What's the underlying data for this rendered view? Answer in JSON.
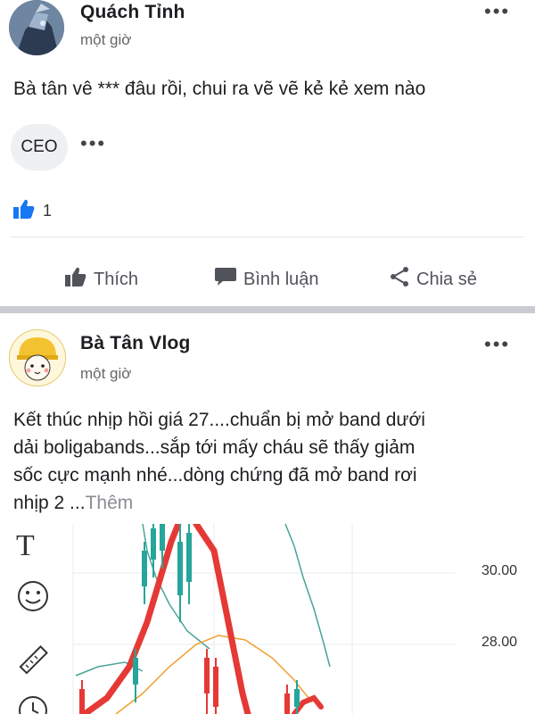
{
  "posts": [
    {
      "author": "Quách Tỉnh",
      "time": "một giờ",
      "text": "Bà tân vê *** đâu rồi, chui ra vẽ vẽ kẻ kẻ xem nào",
      "tag": "CEO",
      "reaction_count": "1",
      "actions": {
        "like": "Thích",
        "comment": "Bình luận",
        "share": "Chia sẻ"
      }
    },
    {
      "author": "Bà Tân Vlog",
      "time": "một giờ",
      "text_lines": [
        "Kết thúc nhịp hồi giá 27....chuẩn bị mở band dưới",
        "dải boligabands...sắp tới mấy cháu sẽ thấy giảm",
        "sốc cực mạnh nhé...dòng chứng đã mở band rơi",
        "nhịp 2 ..."
      ],
      "see_more": "Thêm",
      "chart": {
        "price_labels": [
          "30.00",
          "28.00"
        ],
        "tools": [
          "text-tool-icon",
          "emoji-tool-icon",
          "ruler-tool-icon",
          "clock-tool-icon"
        ]
      }
    }
  ],
  "colors": {
    "like_blue": "#1877f2",
    "red_line": "#e53935",
    "candle_green": "#26a69a",
    "orange_line": "#f0a030",
    "teal_band": "#4aa39a"
  }
}
